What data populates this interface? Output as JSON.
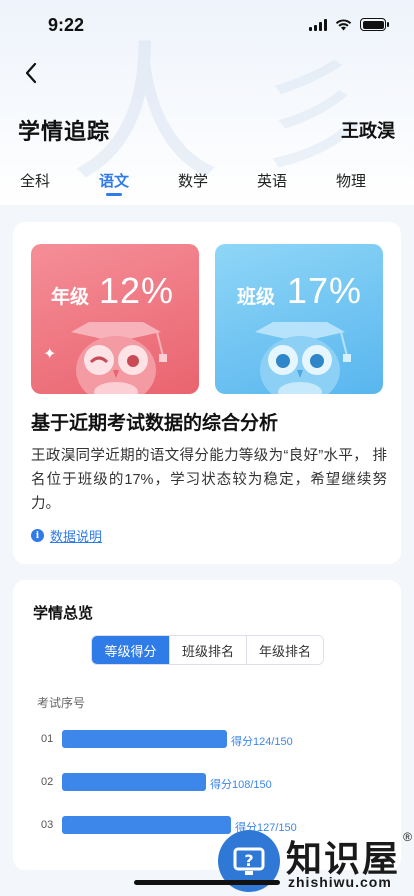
{
  "status_bar": {
    "time": "9:22"
  },
  "header": {
    "title": "学情追踪",
    "student_name": "王政淏"
  },
  "tabs": [
    {
      "label": "全科",
      "active": false
    },
    {
      "label": "语文",
      "active": true
    },
    {
      "label": "数学",
      "active": false
    },
    {
      "label": "英语",
      "active": false
    },
    {
      "label": "物理",
      "active": false
    }
  ],
  "stats": {
    "grade": {
      "label": "年级",
      "value": "12%"
    },
    "class": {
      "label": "班级",
      "value": "17%"
    }
  },
  "analysis": {
    "title": "基于近期考试数据的综合分析",
    "body": "王政淏同学近期的语文得分能力等级为“良好”水平， 排名位于班级的17%，学习状态较为稳定，希望继续努力。",
    "data_note": "数据说明"
  },
  "overview": {
    "title": "学情总览",
    "segments": [
      {
        "label": "等级得分",
        "active": true
      },
      {
        "label": "班级排名",
        "active": false
      },
      {
        "label": "年级排名",
        "active": false
      }
    ],
    "axis_label": "考试序号"
  },
  "chart_data": {
    "type": "bar",
    "orientation": "horizontal",
    "categories": [
      "01",
      "02",
      "03"
    ],
    "values": [
      124,
      108,
      127
    ],
    "max": 150,
    "value_labels": [
      "得分124/150",
      "得分108/150",
      "得分127/150"
    ],
    "bar_color": "#3d86ea"
  },
  "watermark": {
    "brand": "知识屋",
    "domain": "zhishiwu.com",
    "reg": "®"
  },
  "colors": {
    "accent": "#2f7be8",
    "grade_card": "#ec6e79",
    "class_card": "#64bcef"
  }
}
